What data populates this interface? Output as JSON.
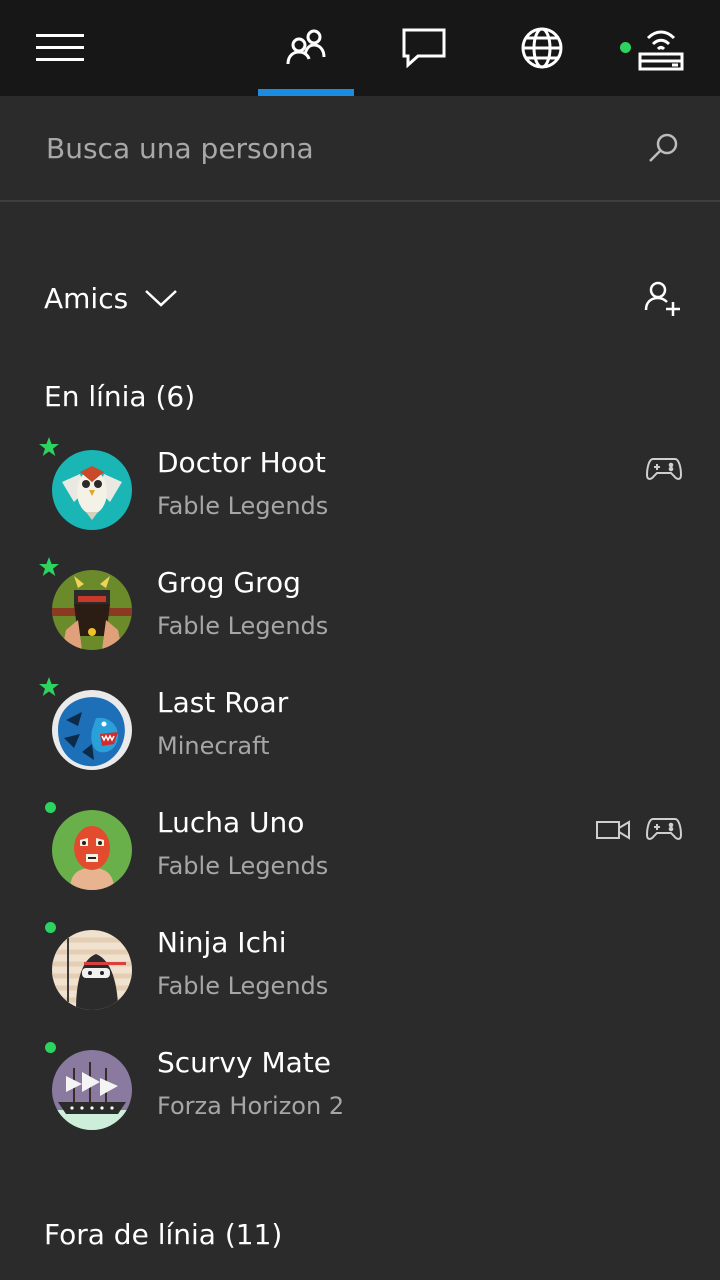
{
  "header": {
    "menu_icon": "hamburger-menu-icon",
    "tabs": [
      {
        "icon": "friends-icon",
        "active": true
      },
      {
        "icon": "chat-icon",
        "active": false
      },
      {
        "icon": "globe-icon",
        "active": false
      },
      {
        "icon": "network-icon",
        "active": false
      }
    ],
    "accent_color": "#1c8ce0",
    "status_color": "#2dd35f"
  },
  "search": {
    "placeholder": "Busca una persona"
  },
  "filter": {
    "label": "Amics"
  },
  "online_section": {
    "label": "En línia (6)"
  },
  "friends": [
    {
      "name": "Doctor Hoot",
      "game": "Fable Legends",
      "badge": "favorite-star",
      "icons": [
        "controller-icon"
      ]
    },
    {
      "name": "Grog Grog",
      "game": "Fable Legends",
      "badge": "favorite-star",
      "icons": []
    },
    {
      "name": "Last Roar",
      "game": "Minecraft",
      "badge": "favorite-star",
      "icons": []
    },
    {
      "name": "Lucha Uno",
      "game": "Fable Legends",
      "badge": "online-dot",
      "icons": [
        "video-camera-icon",
        "controller-icon"
      ]
    },
    {
      "name": "Ninja Ichi",
      "game": "Fable Legends",
      "badge": "online-dot",
      "icons": []
    },
    {
      "name": "Scurvy Mate",
      "game": "Forza Horizon 2",
      "badge": "online-dot",
      "icons": []
    }
  ],
  "offline_section": {
    "label": "Fora de línia (11)"
  }
}
